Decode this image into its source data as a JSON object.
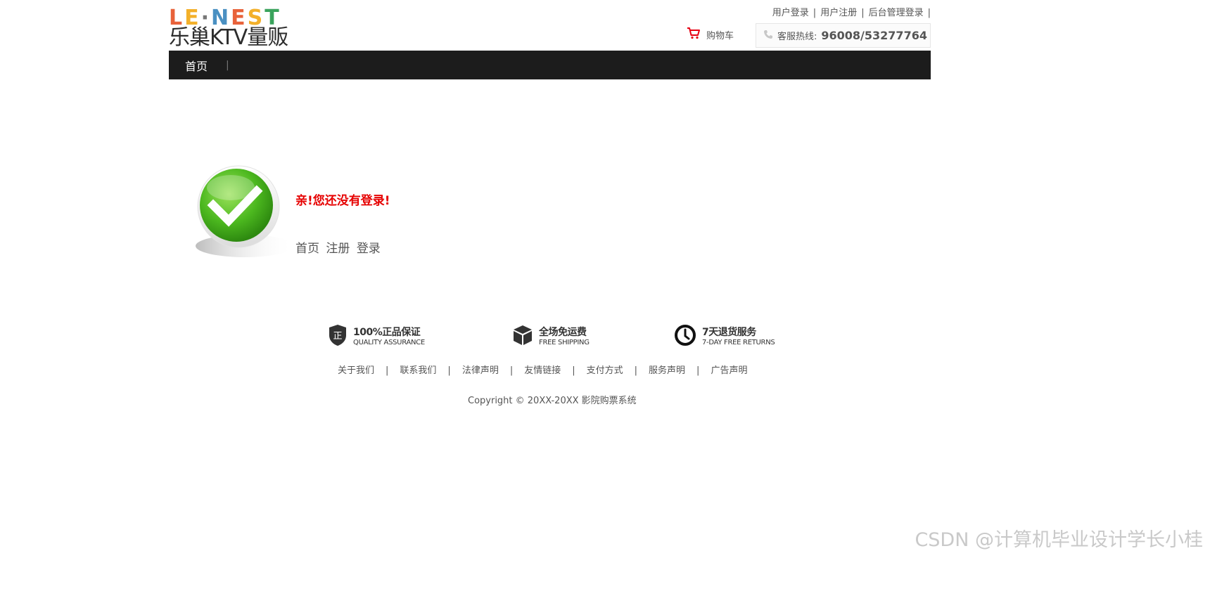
{
  "brand": {
    "logo_letters": [
      "L",
      "E",
      "·",
      "N",
      "E",
      "S",
      "T"
    ],
    "logo_letter_colors": [
      "#e8623a",
      "#f3b02a",
      "#777777",
      "#4a90c2",
      "#e8623a",
      "#f3b02a",
      "#3aa35c"
    ],
    "logo_name": "乐巢KTV量贩"
  },
  "toplinks": {
    "user_login": "用户登录",
    "user_register": "用户注册",
    "admin_login": "后台管理登录",
    "separator": "|"
  },
  "cart": {
    "label": "购物车",
    "icon": "cart-icon",
    "color": "#e60012"
  },
  "hotline": {
    "label": "客服热线:",
    "number": "96008/53277764",
    "icon": "phone-icon"
  },
  "nav": {
    "items": [
      {
        "label": "首页"
      }
    ],
    "separator": "|"
  },
  "message": {
    "icon": "checkmark-icon",
    "title": "亲!您还没有登录!",
    "links": {
      "home": "首页",
      "register": "注册",
      "login": "登录"
    }
  },
  "features": [
    {
      "icon": "shield-icon",
      "title": "100%正品保证",
      "subtitle": "QUALITY ASSURANCE"
    },
    {
      "icon": "box-icon",
      "title": "全场免运费",
      "subtitle": "FREE SHIPPING"
    },
    {
      "icon": "clock-icon",
      "title": "7天退货服务",
      "subtitle": "7-DAY FREE RETURNS"
    }
  ],
  "footer": {
    "links": [
      "关于我们",
      "联系我们",
      "法律声明",
      "友情链接",
      "支付方式",
      "服务声明",
      "广告声明"
    ],
    "separator": "|",
    "copyright": "Copyright © 20XX-20XX 影院购票系统"
  },
  "watermark": "CSDN @计算机毕业设计学长小桂"
}
